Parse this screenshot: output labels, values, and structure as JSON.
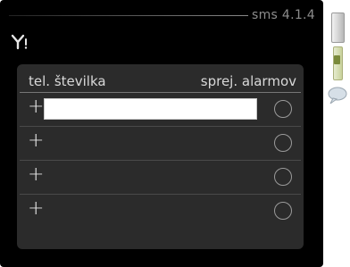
{
  "header": {
    "title": "sms 4.1.4",
    "icon": "antenna-signal-icon"
  },
  "table": {
    "columns": {
      "left": "tel. številka",
      "right": "sprej. alarmov"
    },
    "rows": [
      {
        "add_symbol": "+",
        "phone_value": "",
        "alarm_selected": false,
        "editing": true
      },
      {
        "add_symbol": "+",
        "phone_value": "",
        "alarm_selected": false,
        "editing": false
      },
      {
        "add_symbol": "+",
        "phone_value": "",
        "alarm_selected": false,
        "editing": false
      },
      {
        "add_symbol": "+",
        "phone_value": "",
        "alarm_selected": false,
        "editing": false
      }
    ]
  },
  "side_controls": {
    "scroll_icon": "scrollbar-handle",
    "slider_icon": "menu-position-slider",
    "help_icon": "help-bubble-icon"
  },
  "colors": {
    "screen_background": "#000000",
    "panel_background": "#2b2b2b",
    "text": "#d8d8d8"
  }
}
